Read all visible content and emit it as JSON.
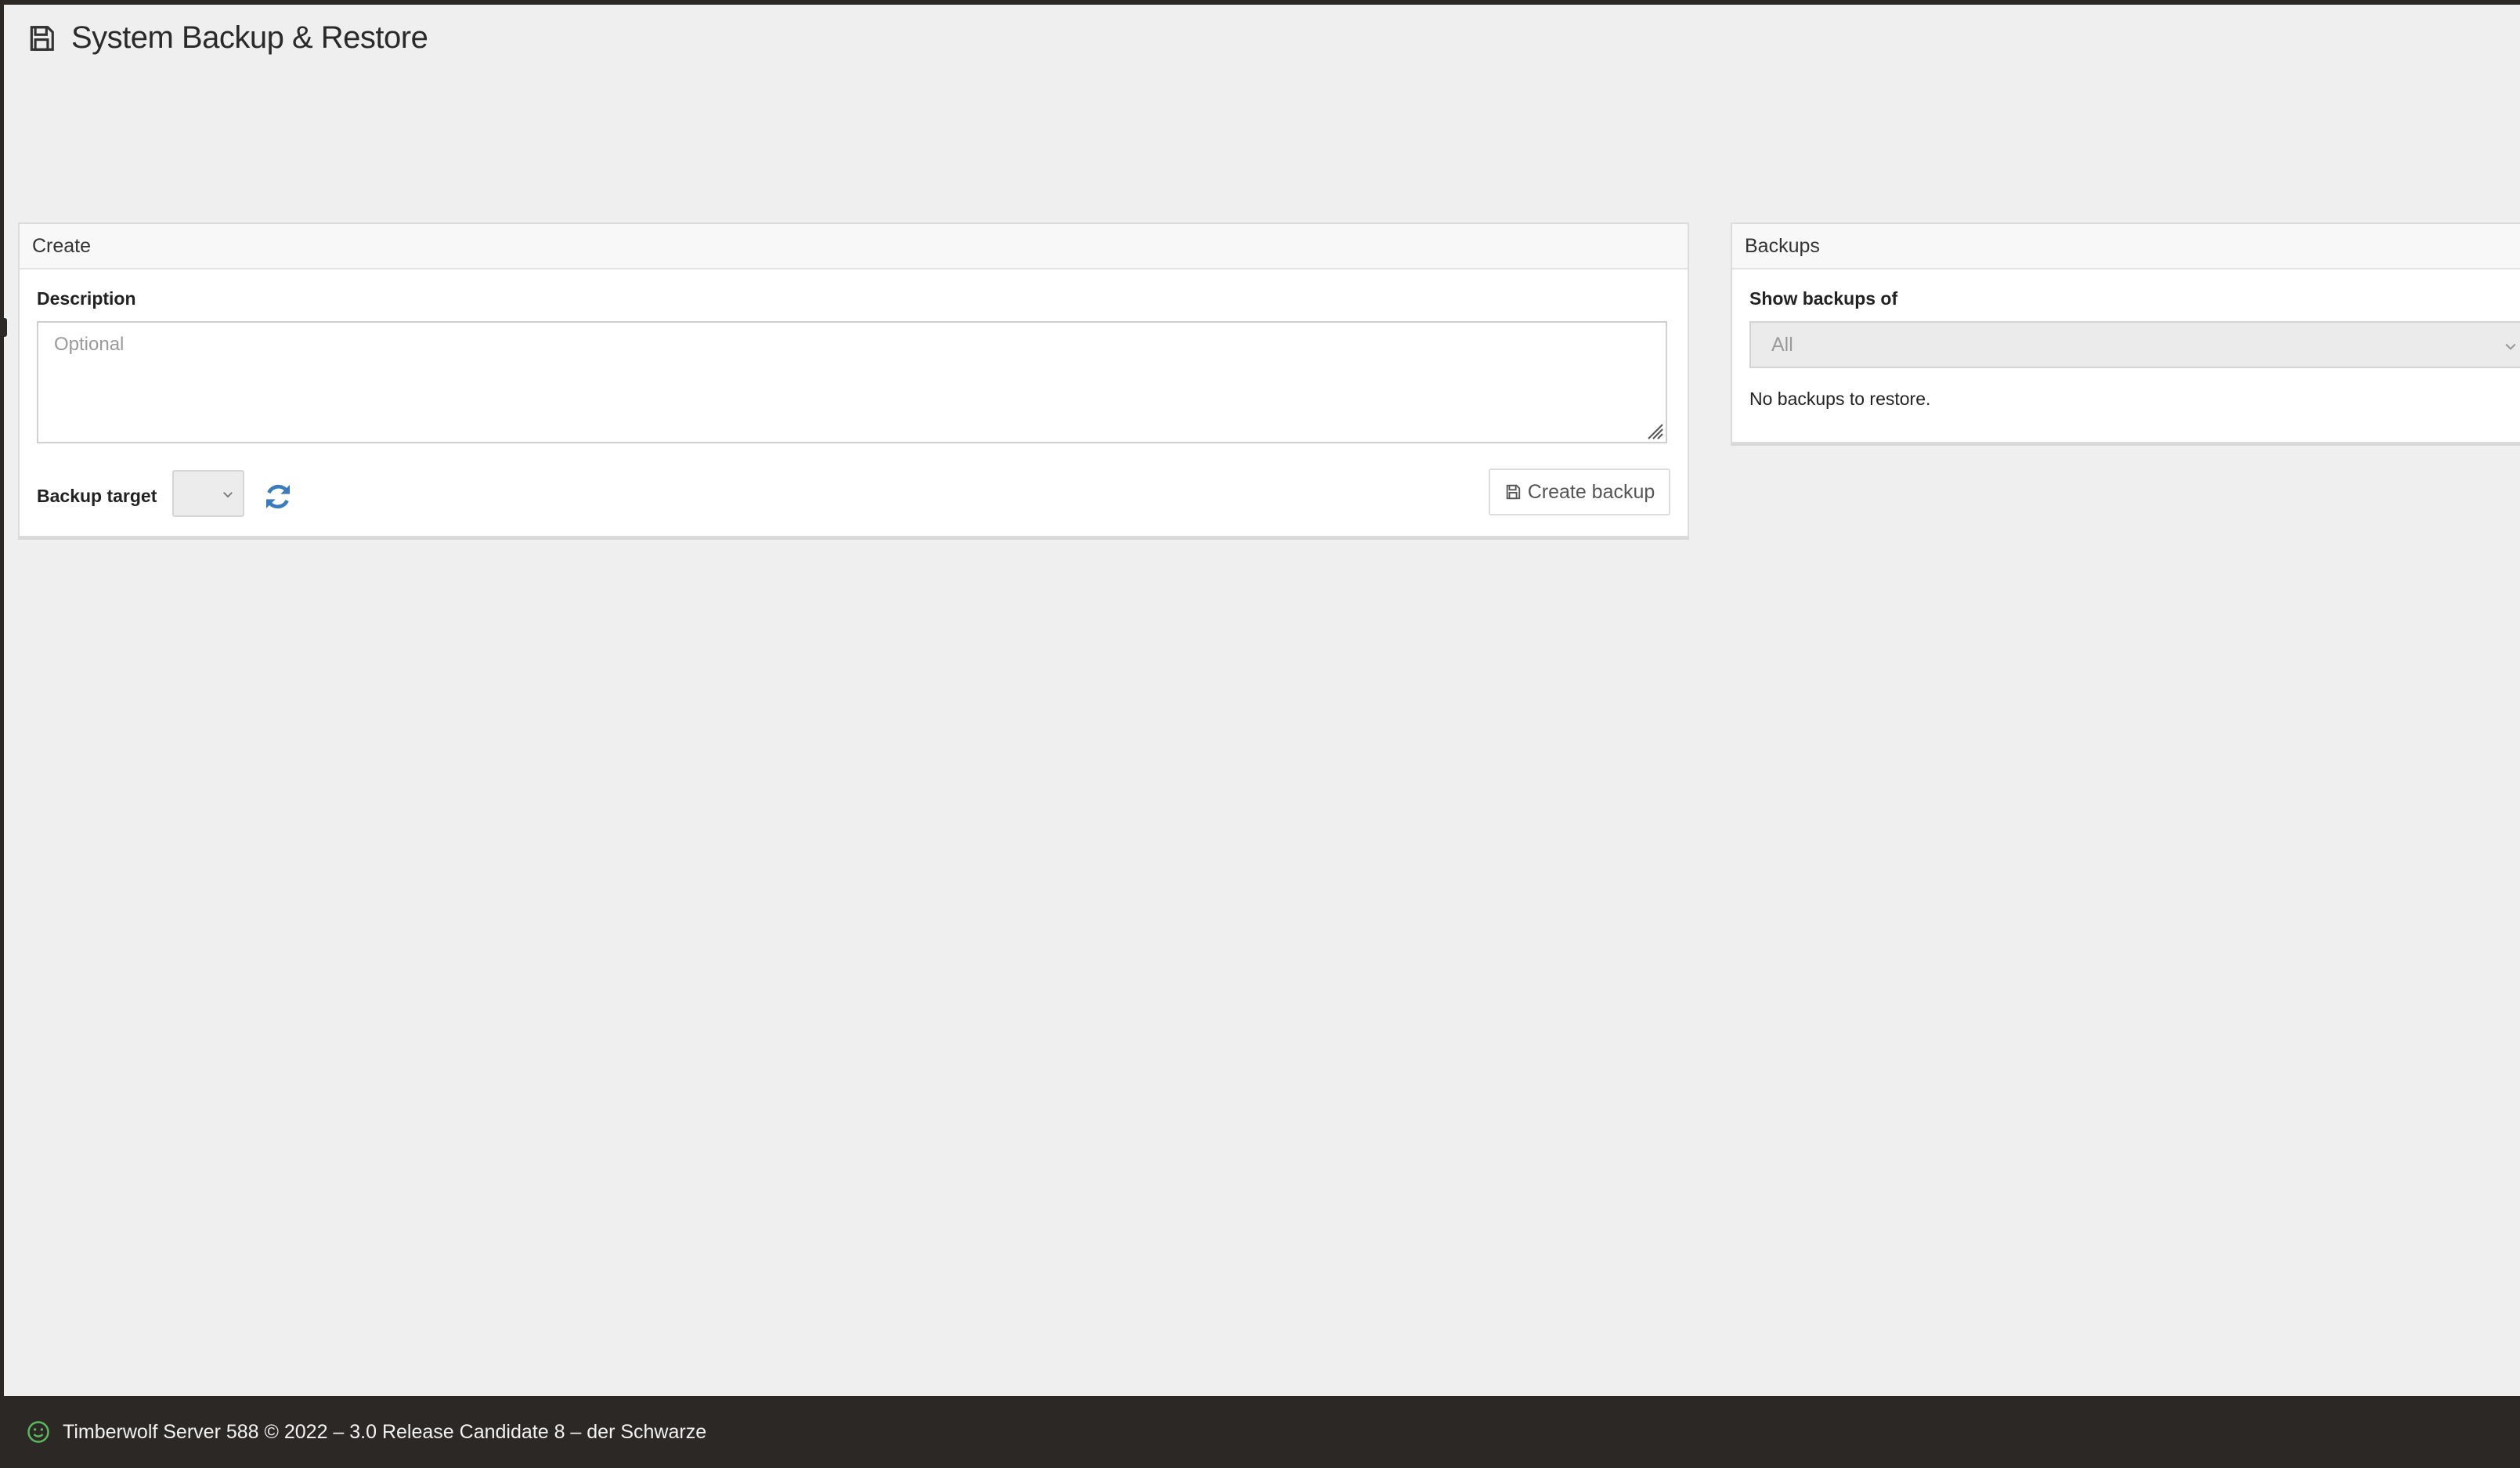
{
  "page": {
    "title": "System Backup & Restore",
    "icon": "save-icon"
  },
  "create_panel": {
    "heading": "Create",
    "description_label": "Description",
    "description_value": "",
    "description_placeholder": "Optional",
    "backup_target_label": "Backup target",
    "backup_target_value": "",
    "refresh_icon": "refresh-icon",
    "create_button_label": "Create backup",
    "create_button_icon": "save-icon"
  },
  "backups_panel": {
    "heading": "Backups",
    "show_label": "Show backups of",
    "show_value": "All",
    "empty_message": "No backups to restore."
  },
  "footer": {
    "status_icon": "smiley-icon",
    "text": "Timberwolf Server 588 © 2022 – 3.0 Release Candidate 8 – der Schwarze"
  },
  "colors": {
    "accent_blue": "#3a7bbf",
    "status_green": "#5cb85c",
    "footer_bg": "#2b2826",
    "page_bg": "#efefef"
  }
}
